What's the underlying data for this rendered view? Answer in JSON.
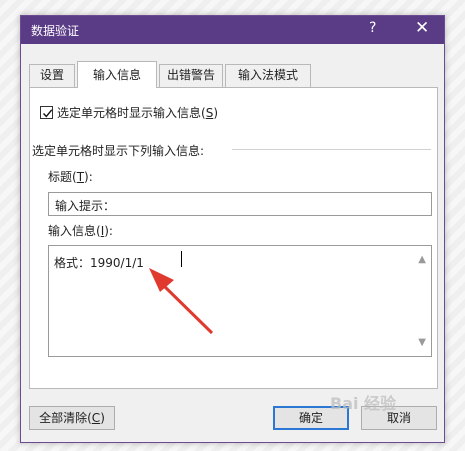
{
  "dialog": {
    "title": "数据验证",
    "help_label": "?",
    "close_label": "✕"
  },
  "tabs": [
    {
      "label": "设置"
    },
    {
      "label": "输入信息"
    },
    {
      "label": "出错警告"
    },
    {
      "label": "输入法模式"
    }
  ],
  "active_tab": "输入信息",
  "checkbox": {
    "label": "选定单元格时显示输入信息(",
    "hotkey": "S",
    "suffix": ")",
    "checked": true
  },
  "section_label": "选定单元格时显示下列输入信息:",
  "title_field": {
    "label_prefix": "标题(",
    "hotkey": "T",
    "label_suffix": "):",
    "value": "输入提示："
  },
  "message_field": {
    "label_prefix": "输入信息(",
    "hotkey": "I",
    "label_suffix": "):",
    "value": "格式：1990/1/1"
  },
  "buttons": {
    "clear_prefix": "全部清除(",
    "clear_hotkey": "C",
    "clear_suffix": ")",
    "ok": "确定",
    "cancel": "取消"
  },
  "watermark": "Bai 经验",
  "colors": {
    "titlebar": "#5a3b86",
    "arrow": "#e03a2f",
    "primary_border": "#2b78d4"
  }
}
